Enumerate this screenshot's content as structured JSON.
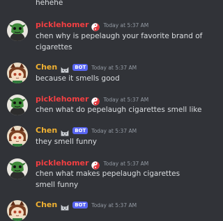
{
  "messages": [
    {
      "type": "continuation",
      "lines": [
        "hehehe"
      ]
    },
    {
      "type": "message",
      "author": "picklehomer",
      "bot": false,
      "timestamp": "Today at 5:37 AM",
      "lines": [
        "chen why is pepelaugh your favorite brand of",
        "cigarettes"
      ]
    },
    {
      "type": "message",
      "author": "Chen",
      "bot": true,
      "bot_label": "BOT",
      "timestamp": "Today at 5:37 AM",
      "lines": [
        "because it smells good"
      ]
    },
    {
      "type": "message",
      "author": "picklehomer",
      "bot": false,
      "timestamp": "Today at 5:37 AM",
      "lines": [
        "chen what do pepelaugh cigarettes smell like"
      ]
    },
    {
      "type": "message",
      "author": "Chen",
      "bot": true,
      "bot_label": "BOT",
      "timestamp": "Today at 5:37 AM",
      "lines": [
        "they smell funny"
      ]
    },
    {
      "type": "message",
      "author": "picklehomer",
      "bot": false,
      "timestamp": "Today at 5:37 AM",
      "lines": [
        "chen what makes pepelaugh cigarettes",
        "smell funny"
      ]
    },
    {
      "type": "message",
      "author": "Chen",
      "bot": true,
      "bot_label": "BOT",
      "timestamp": "Today at 5:37 AM",
      "lines": []
    }
  ],
  "colors": {
    "background": "#313338",
    "text": "#dbdee1",
    "timestamp": "#949ba4",
    "picklehomer": "#f23f42",
    "chen": "#f0b132",
    "bot_tag": "#5865f2"
  },
  "icons": {
    "picklehomer_badge": "yin-yang-icon",
    "chen_badge": "cat-face-icon"
  }
}
